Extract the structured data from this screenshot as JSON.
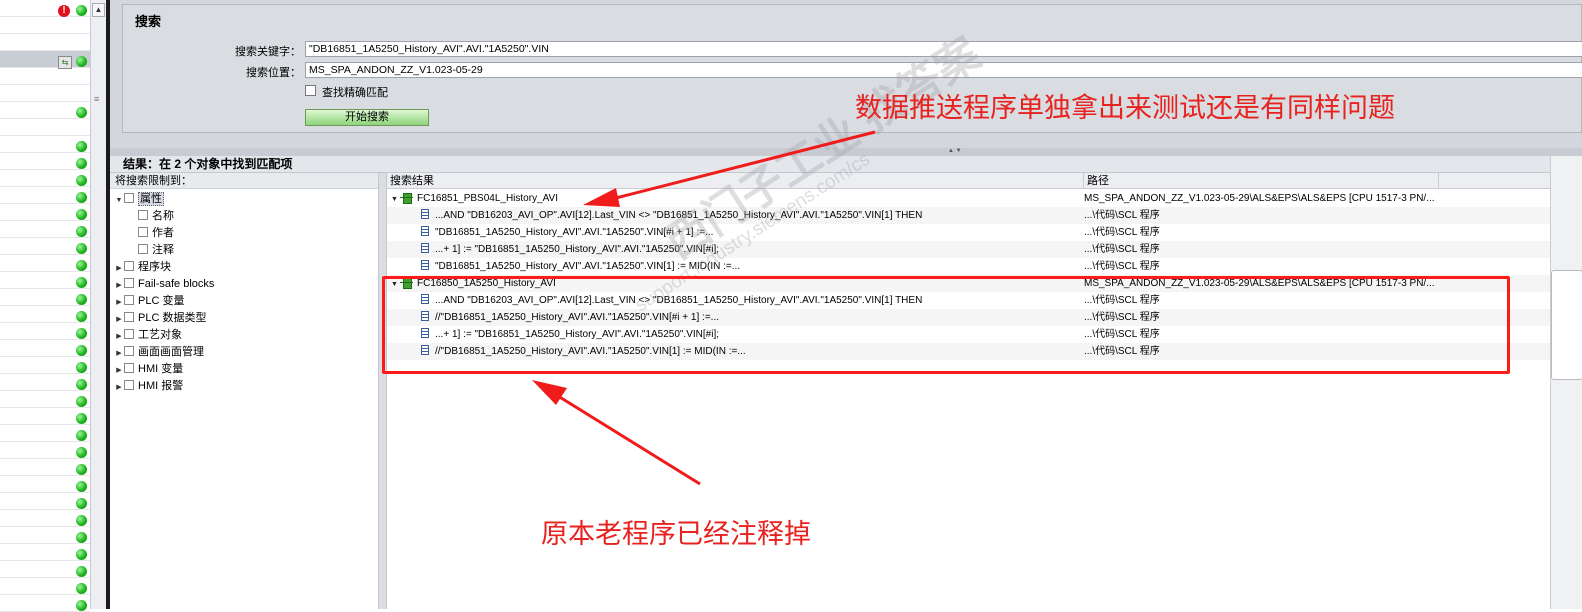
{
  "search_panel": {
    "title": "搜索",
    "keyword_label": "搜索关键字：",
    "keyword_value": "\"DB16851_1A5250_History_AVI\".AVI.\"1A5250\".VIN",
    "location_label": "搜索位置：",
    "location_value": "MS_SPA_ANDON_ZZ_V1.023-05-29",
    "exact_match_label": "查找精确匹配",
    "exact_match_checked": false,
    "start_button": "开始搜索"
  },
  "results": {
    "header": "结果：在 2 个对象中找到匹配项",
    "filter_title": "将搜索限制到：",
    "filters": [
      {
        "label": "属性",
        "expanded": true,
        "indent": 0,
        "selected": true
      },
      {
        "label": "名称",
        "indent": 1
      },
      {
        "label": "作者",
        "indent": 1
      },
      {
        "label": "注释",
        "indent": 1
      },
      {
        "label": "程序块",
        "expanded": false,
        "indent": 0
      },
      {
        "label": "Fail-safe blocks",
        "expanded": false,
        "indent": 0
      },
      {
        "label": "PLC 变量",
        "expanded": false,
        "indent": 0
      },
      {
        "label": "PLC 数据类型",
        "expanded": false,
        "indent": 0
      },
      {
        "label": "工艺对象",
        "expanded": false,
        "indent": 0
      },
      {
        "label": "画面画面管理",
        "expanded": false,
        "indent": 0
      },
      {
        "label": "HMI 变量",
        "expanded": false,
        "indent": 0
      },
      {
        "label": "HMI 报警",
        "expanded": false,
        "indent": 0
      }
    ],
    "columns": {
      "result": "搜索结果",
      "path": "路径"
    },
    "rows": [
      {
        "type": "group",
        "text": "FC16851_PBS04L_History_AVI",
        "path": "MS_SPA_ANDON_ZZ_V1.023-05-29\\ALS&EPS\\ALS&EPS [CPU 1517-3 PN/..."
      },
      {
        "type": "item",
        "text": "...AND \"DB16203_AVI_OP\".AVI[12].Last_VIN <> \"DB16851_1A5250_History_AVI\".AVI.\"1A5250\".VIN[1] THEN",
        "path": "...\\代码\\SCL 程序"
      },
      {
        "type": "item",
        "text": "\"DB16851_1A5250_History_AVI\".AVI.\"1A5250\".VIN[#i + 1] :=...",
        "path": "...\\代码\\SCL 程序"
      },
      {
        "type": "item",
        "text": "...+ 1] := \"DB16851_1A5250_History_AVI\".AVI.\"1A5250\".VIN[#i];",
        "path": "...\\代码\\SCL 程序"
      },
      {
        "type": "item",
        "text": "\"DB16851_1A5250_History_AVI\".AVI.\"1A5250\".VIN[1] := MID(IN :=...",
        "path": "...\\代码\\SCL 程序"
      },
      {
        "type": "group",
        "text": "FC16850_1A5250_History_AVI",
        "path": "MS_SPA_ANDON_ZZ_V1.023-05-29\\ALS&EPS\\ALS&EPS [CPU 1517-3 PN/..."
      },
      {
        "type": "item",
        "text": "...AND \"DB16203_AVI_OP\".AVI[12].Last_VIN <> \"DB16851_1A5250_History_AVI\".AVI.\"1A5250\".VIN[1] THEN",
        "path": "...\\代码\\SCL 程序"
      },
      {
        "type": "item",
        "text": "//\"DB16851_1A5250_History_AVI\".AVI.\"1A5250\".VIN[#i + 1] :=...",
        "path": "...\\代码\\SCL 程序"
      },
      {
        "type": "item",
        "text": "...+ 1] := \"DB16851_1A5250_History_AVI\".AVI.\"1A5250\".VIN[#i];",
        "path": "...\\代码\\SCL 程序"
      },
      {
        "type": "item",
        "text": "//\"DB16851_1A5250_History_AVI\".AVI.\"1A5250\".VIN[1] := MID(IN :=...",
        "path": "...\\代码\\SCL 程序"
      }
    ]
  },
  "annotations": {
    "top_note": "数据推送程序单独拿出来测试还是有同样问题",
    "bottom_note": "原本老程序已经注释掉",
    "color": "#e8221f"
  },
  "watermark": {
    "line1": "西门子工业 找答案",
    "line2": "support.industry.siemens.com/cs"
  },
  "left_tree": {
    "error_icon": "!"
  }
}
